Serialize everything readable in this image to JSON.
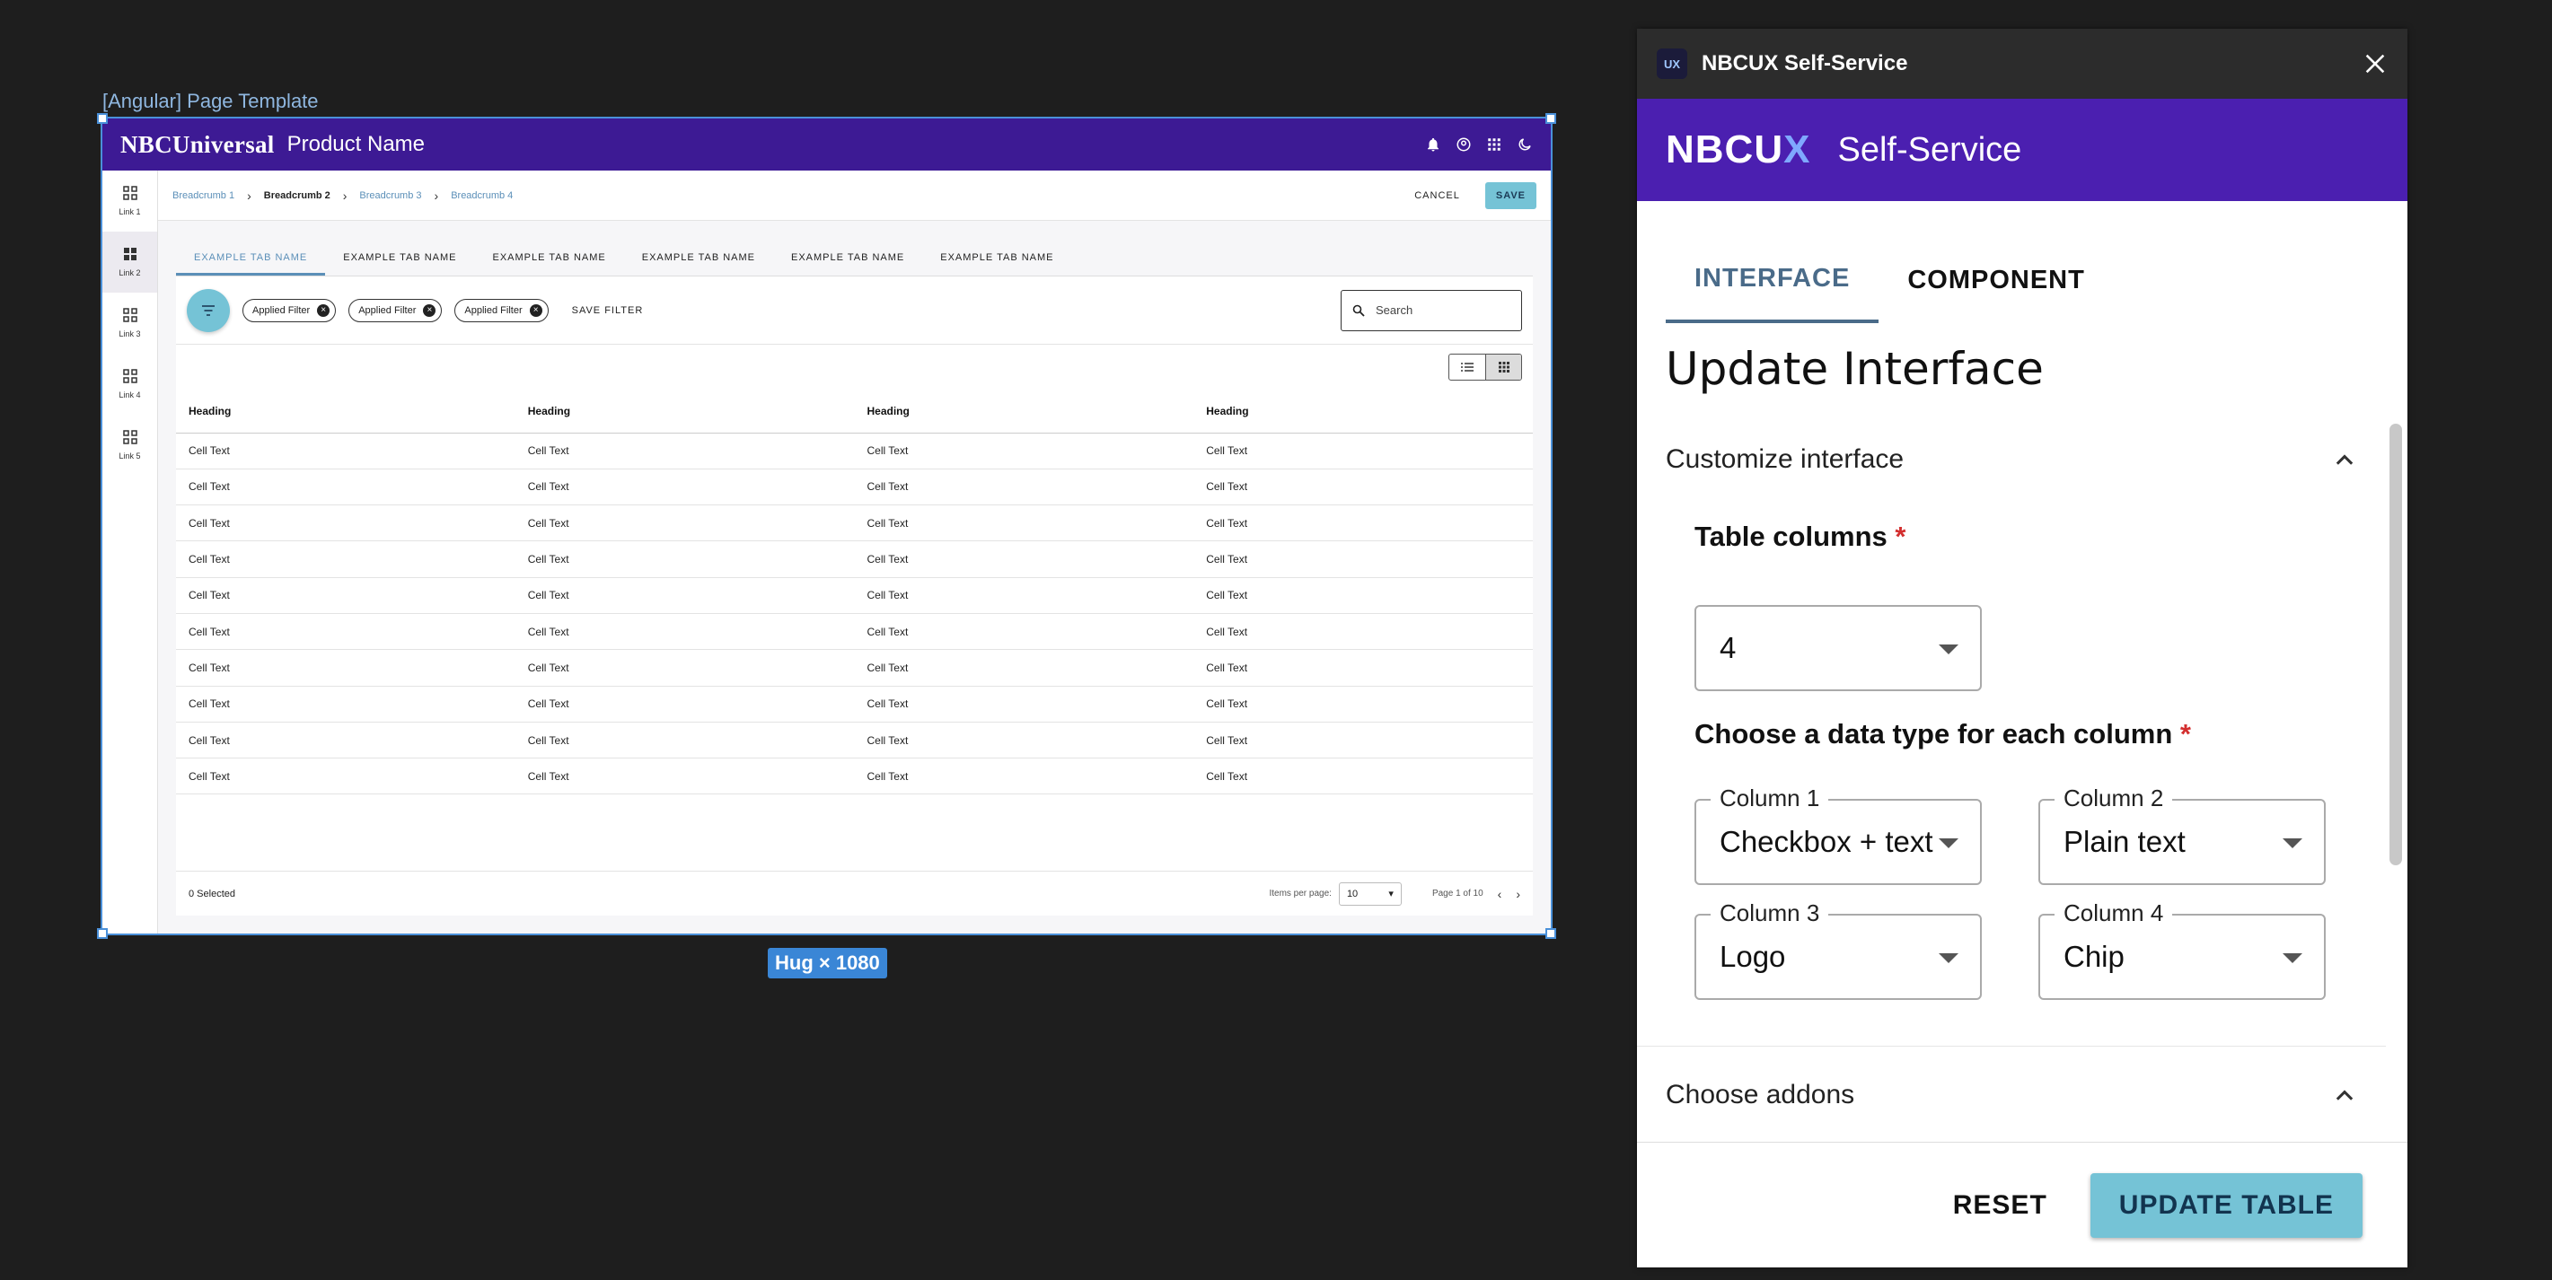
{
  "canvas": {
    "frame_label": "[Angular] Page Template",
    "hug_badge": "Hug × 1080"
  },
  "template": {
    "brand": "NBCUniversal",
    "product_name": "Product Name",
    "header_icons": [
      "bell-icon",
      "account-circle-icon",
      "apps-grid-icon",
      "moon-icon"
    ],
    "nav": [
      {
        "label": "Link 1",
        "active": false
      },
      {
        "label": "Link 2",
        "active": true
      },
      {
        "label": "Link 3",
        "active": false
      },
      {
        "label": "Link 4",
        "active": false
      },
      {
        "label": "Link 5",
        "active": false
      }
    ],
    "breadcrumbs": [
      "Breadcrumb 1",
      "Breadcrumb 2",
      "Breadcrumb 3",
      "Breadcrumb 4"
    ],
    "cancel_label": "CANCEL",
    "save_label": "SAVE",
    "tabs": [
      "EXAMPLE TAB NAME",
      "EXAMPLE TAB NAME",
      "EXAMPLE TAB NAME",
      "EXAMPLE TAB NAME",
      "EXAMPLE TAB NAME",
      "EXAMPLE TAB NAME"
    ],
    "filters": [
      "Applied Filter",
      "Applied Filter",
      "Applied Filter"
    ],
    "save_filter_label": "SAVE FILTER",
    "search_placeholder": "Search",
    "table": {
      "headers": [
        "Heading",
        "Heading",
        "Heading",
        "Heading"
      ],
      "rows": [
        [
          "Cell Text",
          "Cell Text",
          "Cell Text",
          "Cell Text"
        ],
        [
          "Cell Text",
          "Cell Text",
          "Cell Text",
          "Cell Text"
        ],
        [
          "Cell Text",
          "Cell Text",
          "Cell Text",
          "Cell Text"
        ],
        [
          "Cell Text",
          "Cell Text",
          "Cell Text",
          "Cell Text"
        ],
        [
          "Cell Text",
          "Cell Text",
          "Cell Text",
          "Cell Text"
        ],
        [
          "Cell Text",
          "Cell Text",
          "Cell Text",
          "Cell Text"
        ],
        [
          "Cell Text",
          "Cell Text",
          "Cell Text",
          "Cell Text"
        ],
        [
          "Cell Text",
          "Cell Text",
          "Cell Text",
          "Cell Text"
        ],
        [
          "Cell Text",
          "Cell Text",
          "Cell Text",
          "Cell Text"
        ],
        [
          "Cell Text",
          "Cell Text",
          "Cell Text",
          "Cell Text"
        ]
      ]
    },
    "selected_count": "0 Selected",
    "items_per_page_label": "Items per page:",
    "items_per_page_value": "10",
    "page_info": "Page 1 of 10"
  },
  "panel": {
    "app_icon_text": "UX",
    "app_title": "NBCUX Self-Service",
    "brand_logo_main": "NBCU",
    "brand_logo_x": "X",
    "brand_subtitle": "Self-Service",
    "tabs": [
      {
        "label": "INTERFACE",
        "active": true
      },
      {
        "label": "COMPONENT",
        "active": false
      }
    ],
    "heading": "Update Interface",
    "customize_section": {
      "title": "Customize interface",
      "table_columns_label": "Table columns",
      "table_columns_value": "4",
      "data_type_label": "Choose a data type for each column",
      "columns": [
        {
          "label": "Column 1",
          "value": "Checkbox + text"
        },
        {
          "label": "Column 2",
          "value": "Plain text"
        },
        {
          "label": "Column 3",
          "value": "Logo"
        },
        {
          "label": "Column 4",
          "value": "Chip"
        }
      ]
    },
    "addons_section": {
      "title": "Choose addons"
    },
    "reset_label": "RESET",
    "update_label": "UPDATE TABLE"
  },
  "colors": {
    "background": "#1e1e1e",
    "header_purple": "#3d1a94",
    "brand_purple": "#4b1fb0",
    "accent_teal": "#75c3d6",
    "tab_blue": "#4a6b89",
    "required_red": "#d32f2f"
  }
}
